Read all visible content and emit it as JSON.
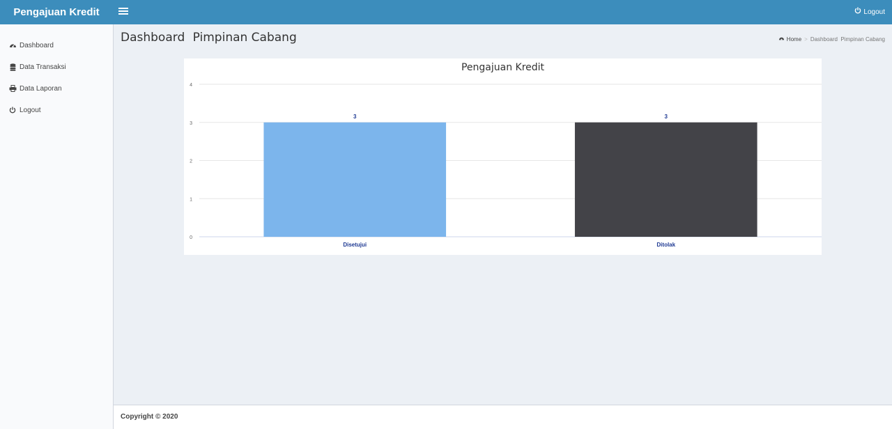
{
  "app": {
    "brand": "Pengajuan Kredit"
  },
  "topbar": {
    "logout_label": "Logout"
  },
  "sidebar": {
    "items": [
      {
        "label": "Dashboard",
        "icon": "dashboard-icon"
      },
      {
        "label": "Data Transaksi",
        "icon": "database-icon"
      },
      {
        "label": "Data Laporan",
        "icon": "printer-icon"
      },
      {
        "label": "Logout",
        "icon": "power-icon"
      }
    ]
  },
  "header": {
    "title": "Dashboard",
    "subtitle": "Pimpinan Cabang"
  },
  "breadcrumb": {
    "home": "Home",
    "current": "Dashboard  Pimpinan Cabang"
  },
  "footer": {
    "text": "Copyright © 2020"
  },
  "colors": {
    "accent": "#3c8dbc",
    "bar_disetujui": "#7cb5ec",
    "bar_ditolak": "#434348"
  },
  "chart_data": {
    "type": "bar",
    "title": "Pengajuan Kredit",
    "categories": [
      "Disetujui",
      "Ditolak"
    ],
    "values": [
      3,
      3
    ],
    "colors": [
      "#7cb5ec",
      "#434348"
    ],
    "ylim": [
      0,
      4
    ],
    "yticks": [
      0,
      1,
      2,
      3,
      4
    ],
    "grid": true
  }
}
